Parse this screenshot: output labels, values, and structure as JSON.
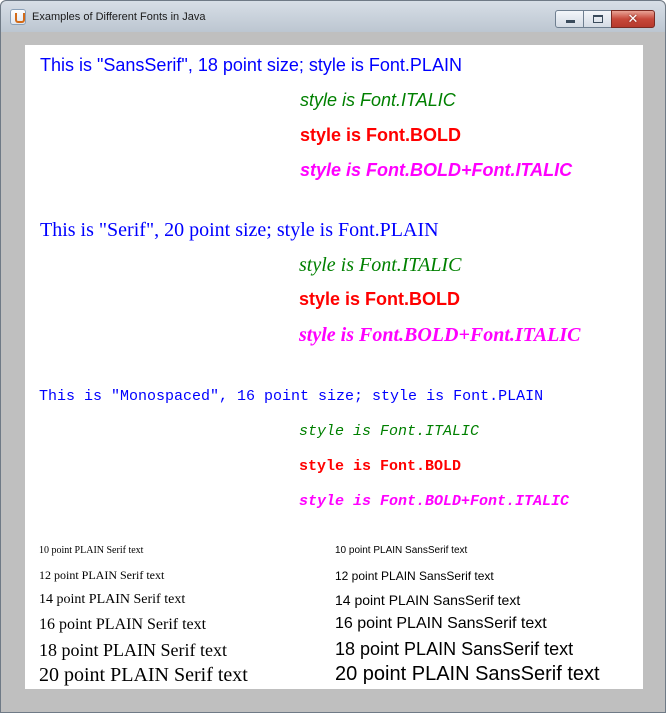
{
  "window": {
    "title": "Examples of Different Fonts in Java"
  },
  "colors": {
    "plain": "#0000ff",
    "italic": "#008000",
    "bold": "#ff0000",
    "bolditalic": "#ff00ff",
    "sizes": "#000000"
  },
  "icons": {
    "app": "java-cup-icon",
    "min": "minimize-icon",
    "max": "maximize-icon",
    "close": "close-icon"
  },
  "sansserif": {
    "plain": "This is \"SansSerif\", 18 point size; style is Font.PLAIN",
    "italic": "style is Font.ITALIC",
    "bold": "style is Font.BOLD",
    "bolditalic": "style is Font.BOLD+Font.ITALIC"
  },
  "serif": {
    "plain": "This is \"Serif\", 20 point size; style is Font.PLAIN",
    "italic": "style is Font.ITALIC",
    "bold": "style is Font.BOLD",
    "bolditalic": "style is Font.BOLD+Font.ITALIC"
  },
  "monospaced": {
    "plain": "This is \"Monospaced\", 16 point size; style is Font.PLAIN",
    "italic": "style is Font.ITALIC",
    "bold": "style is Font.BOLD",
    "bolditalic": "style is Font.BOLD+Font.ITALIC"
  },
  "sizes": {
    "serif": [
      "10 point PLAIN Serif text",
      "12 point PLAIN Serif text",
      "14 point PLAIN Serif text",
      "16 point PLAIN Serif text",
      "18 point PLAIN Serif text",
      "20 point PLAIN Serif text"
    ],
    "sans": [
      "10 point PLAIN SansSerif text",
      "12 point PLAIN SansSerif text",
      "14 point PLAIN SansSerif text",
      "16 point PLAIN SansSerif text",
      "18 point PLAIN SansSerif text",
      "20 point PLAIN SansSerif text"
    ]
  }
}
